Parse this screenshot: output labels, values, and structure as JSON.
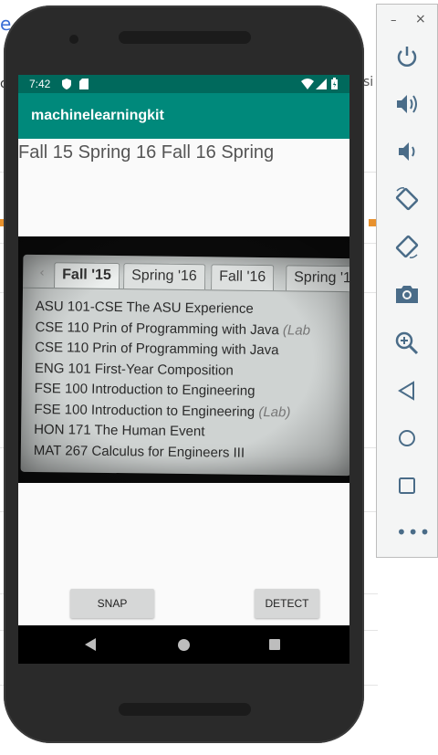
{
  "background": {
    "left_letter": "e",
    "left_fragment": "o",
    "right_fragment": "si"
  },
  "status_bar": {
    "time": "7:42"
  },
  "app_bar": {
    "title": "machinelearningkit"
  },
  "result": {
    "text": "Fall 15 Spring 16 Fall 16 Spring"
  },
  "photo": {
    "tabs": [
      "Fall '15",
      "Spring '16",
      "Fall '16",
      "Spring '1"
    ],
    "courses": [
      {
        "text": "ASU 101-CSE The ASU Experience",
        "suffix": ""
      },
      {
        "text": "CSE 110 Prin of Programming with Java ",
        "suffix": "(Lab"
      },
      {
        "text": "CSE 110 Prin of Programming with Java",
        "suffix": ""
      },
      {
        "text": "ENG 101 First-Year Composition",
        "suffix": ""
      },
      {
        "text": "FSE 100 Introduction to Engineering",
        "suffix": ""
      },
      {
        "text": "FSE 100 Introduction to Engineering ",
        "suffix": "(Lab)"
      },
      {
        "text": "HON 171 The Human Event",
        "suffix": ""
      },
      {
        "text": "MAT 267 Calculus for Engineers III",
        "suffix": ""
      }
    ]
  },
  "buttons": {
    "snap": "SNAP",
    "detect": "DETECT"
  },
  "toolbar": {
    "minimize": "–",
    "close": "×",
    "more": "•••"
  },
  "colors": {
    "status_bar": "#00695c",
    "app_bar": "#00897b",
    "toolbar_icon": "#4a6c88"
  }
}
